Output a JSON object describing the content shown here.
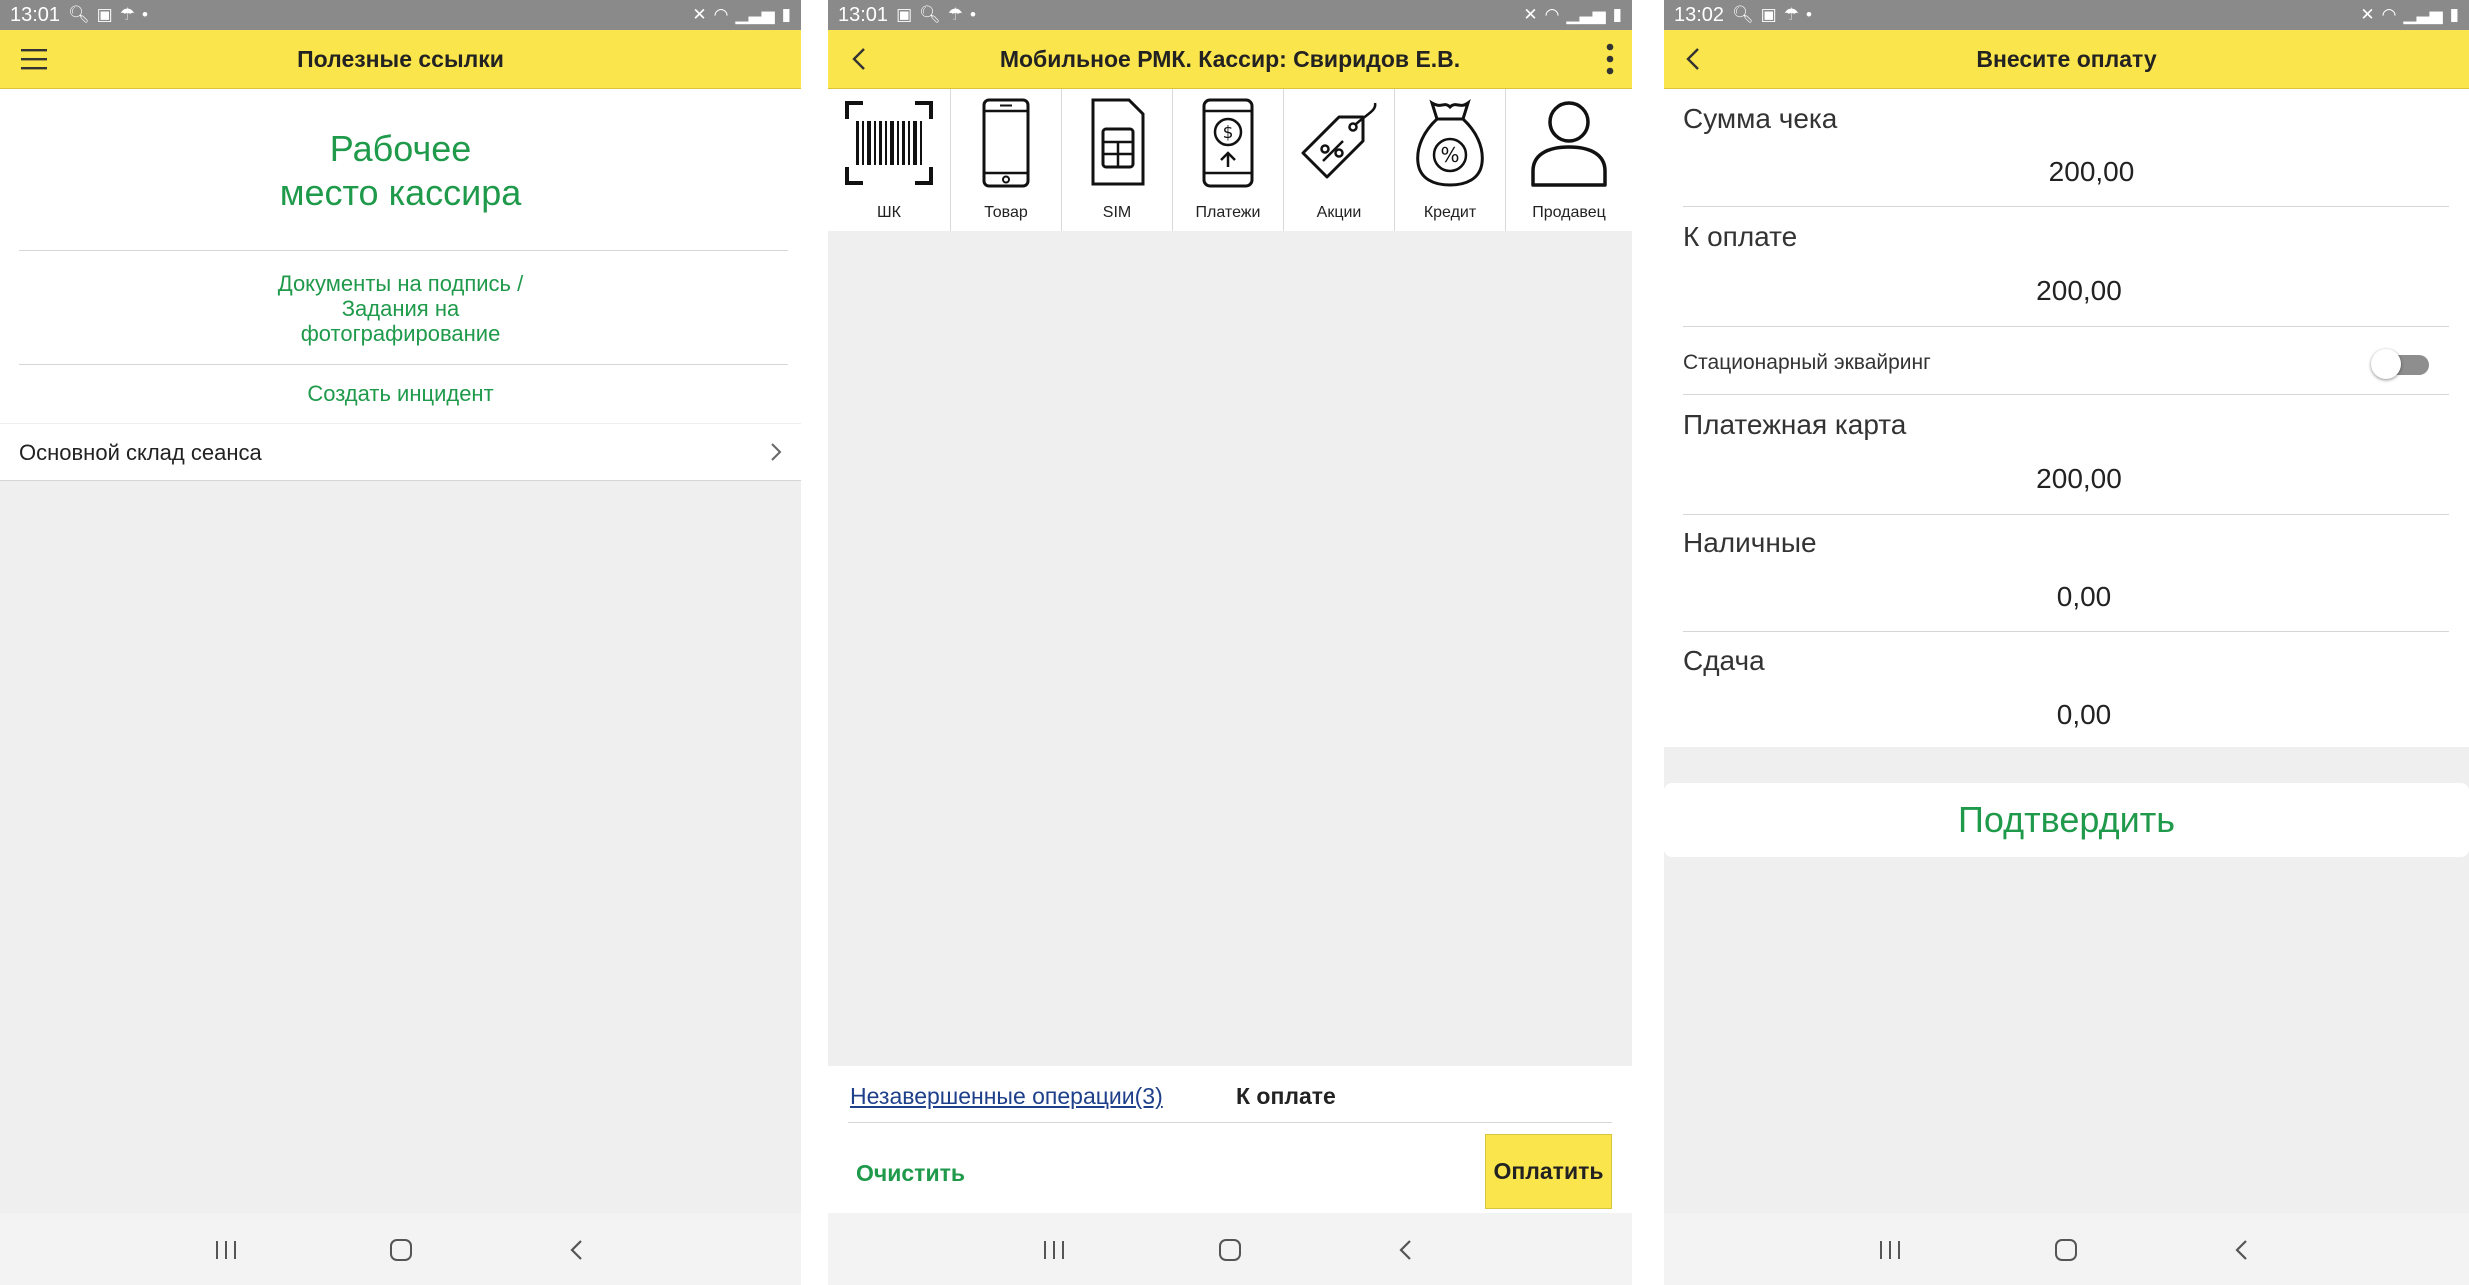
{
  "status": {
    "screen1_time": "13:01",
    "screen2_time": "13:01",
    "screen3_time": "13:02",
    "left_icons": [
      "search-icon",
      "gallery-icon",
      "umbrella-icon",
      "dot-icon"
    ],
    "right_icons": [
      "mute-icon",
      "wifi-icon",
      "signal-icon",
      "battery-icon"
    ]
  },
  "screen1": {
    "title": "Полезные ссылки",
    "workplace_line1": "Рабочее",
    "workplace_line2": "место кассира",
    "documents_link": "Документы на подпись /\nЗадания на\nфотографирование",
    "incident_link": "Создать инцидент",
    "warehouse_label": "Основной склад сеанса"
  },
  "screen2": {
    "title": "Мобильное РМК. Кассир: Свиридов Е.В.",
    "tools": [
      {
        "label": "ШК",
        "icon": "barcode-scan-icon"
      },
      {
        "label": "Товар",
        "icon": "smartphone-icon"
      },
      {
        "label": "SIM",
        "icon": "sim-card-icon"
      },
      {
        "label": "Платежи",
        "icon": "phone-payment-icon"
      },
      {
        "label": "Акции",
        "icon": "discount-tag-icon"
      },
      {
        "label": "Кредит",
        "icon": "money-bag-icon"
      },
      {
        "label": "Продавец",
        "icon": "user-icon"
      }
    ],
    "pending_operations": "Незавершенные операции(3)",
    "to_pay_label": "К оплате",
    "clear_button": "Очистить",
    "pay_button": "Оплатить"
  },
  "screen3": {
    "title": "Внесите оплату",
    "receipt_sum_label": "Сумма чека",
    "receipt_sum_value": "200,00",
    "to_pay_label": "К оплате",
    "to_pay_value": "200,00",
    "stationary_acquiring_label": "Стационарный эквайринг",
    "stationary_acquiring_on": false,
    "card_label": "Платежная карта",
    "card_value": "200,00",
    "cash_label": "Наличные",
    "cash_value": "0,00",
    "change_label": "Сдача",
    "change_value": "0,00",
    "confirm_button": "Подтвердить"
  },
  "colors": {
    "appbar_yellow": "#fbe54d",
    "accent_green": "#1f9a4b",
    "link_blue": "#1e3f8a",
    "background_gray": "#efefef",
    "statusbar_gray": "#8a8a8a"
  }
}
